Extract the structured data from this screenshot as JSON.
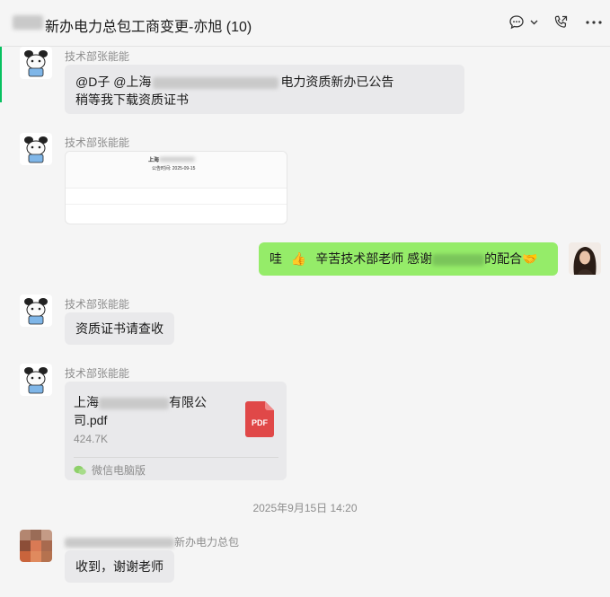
{
  "header": {
    "title": "新办电力总包工商变更-亦旭 (10)",
    "icons": [
      "chat-icon",
      "chevron-down-icon",
      "call-icon",
      "more-icon"
    ]
  },
  "messages": [
    {
      "sender": "技术部张能能",
      "line1_prefix": "@D子  @上海",
      "line1_suffix": "电力资质新办已公告",
      "line2": "稍等我下载资质证书"
    },
    {
      "sender": "技术部张能能",
      "image_title": "上海",
      "image_subtitle": "公告时间: 2025-09-15"
    },
    {
      "text_prefix": "哇",
      "thumb_emoji": "👍",
      "text_mid": "辛苦技术部老师   感谢",
      "text_suffix": "的配合",
      "handshake_emoji": "🤝"
    },
    {
      "sender": "技术部张能能",
      "text": "资质证书请查收"
    },
    {
      "sender": "技术部张能能",
      "file_name_line1_prefix": "上海",
      "file_name_line1_suffix": "有限公",
      "file_name_line2": "司.pdf",
      "file_size": "424.7K",
      "file_badge": "PDF",
      "source": "微信电脑版"
    }
  ],
  "timestamp": "2025年9月15日 14:20",
  "last_message": {
    "sender_suffix": "新办电力总包",
    "text": "收到，谢谢老师"
  },
  "colors": {
    "accent": "#07c160",
    "self_bubble": "#95ec69",
    "other_bubble": "#e9e9eb",
    "pdf_red": "#e04848"
  }
}
